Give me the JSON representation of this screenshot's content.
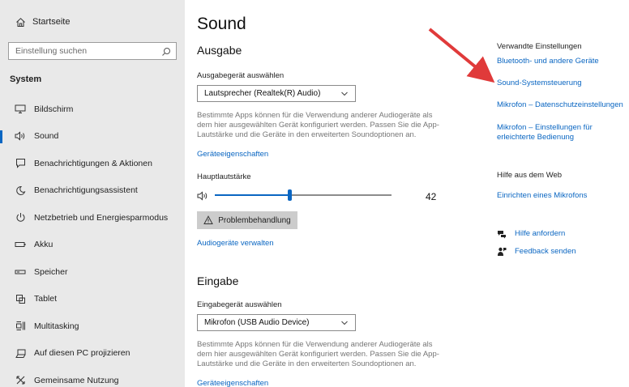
{
  "sidebar": {
    "home_label": "Startseite",
    "search_placeholder": "Einstellung suchen",
    "section_title": "System",
    "items": [
      {
        "label": "Bildschirm",
        "icon": "monitor-icon"
      },
      {
        "label": "Sound",
        "icon": "speaker-icon",
        "active": true
      },
      {
        "label": "Benachrichtigungen & Aktionen",
        "icon": "message-icon"
      },
      {
        "label": "Benachrichtigungsassistent",
        "icon": "moon-icon"
      },
      {
        "label": "Netzbetrieb und Energiesparmodus",
        "icon": "power-icon"
      },
      {
        "label": "Akku",
        "icon": "battery-icon"
      },
      {
        "label": "Speicher",
        "icon": "storage-icon"
      },
      {
        "label": "Tablet",
        "icon": "tablet-icon"
      },
      {
        "label": "Multitasking",
        "icon": "multitasking-icon"
      },
      {
        "label": "Auf diesen PC projizieren",
        "icon": "project-icon"
      },
      {
        "label": "Gemeinsame Nutzung",
        "icon": "share-icon"
      }
    ]
  },
  "main": {
    "title": "Sound",
    "output": {
      "heading": "Ausgabe",
      "device_label": "Ausgabegerät auswählen",
      "device_value": "Lautsprecher (Realtek(R) Audio)",
      "description": "Bestimmte Apps können für die Verwendung anderer Audiogeräte als dem hier ausgewählten Gerät konfiguriert werden. Passen Sie die App-Lautstärke und die Geräte in den erweiterten Soundoptionen an.",
      "properties_link": "Geräteeigenschaften",
      "volume_label": "Hauptlautstärke",
      "volume_value": "42",
      "volume_fraction": 0.42,
      "troubleshoot_label": "Problembehandlung",
      "manage_link": "Audiogeräte verwalten"
    },
    "input": {
      "heading": "Eingabe",
      "device_label": "Eingabegerät auswählen",
      "device_value": "Mikrofon (USB Audio Device)",
      "description": "Bestimmte Apps können für die Verwendung anderer Audiogeräte als dem hier ausgewählten Gerät konfiguriert werden. Passen Sie die App-Lautstärke und die Geräte in den erweiterten Soundoptionen an.",
      "properties_link": "Geräteeigenschaften"
    }
  },
  "related": {
    "title": "Verwandte Einstellungen",
    "links": [
      "Bluetooth- und andere Geräte",
      "Sound-Systemsteuerung",
      "Mikrofon – Datenschutzeinstellungen",
      "Mikrofon – Einstellungen für erleichterte Bedienung"
    ],
    "web_title": "Hilfe aus dem Web",
    "web_link": "Einrichten eines Mikrofons",
    "help_label": "Hilfe anfordern",
    "feedback_label": "Feedback senden"
  },
  "colors": {
    "accent": "#0a66c2",
    "sidebar_bg": "#e9e9e9",
    "annotation_arrow": "#e03a3a"
  }
}
